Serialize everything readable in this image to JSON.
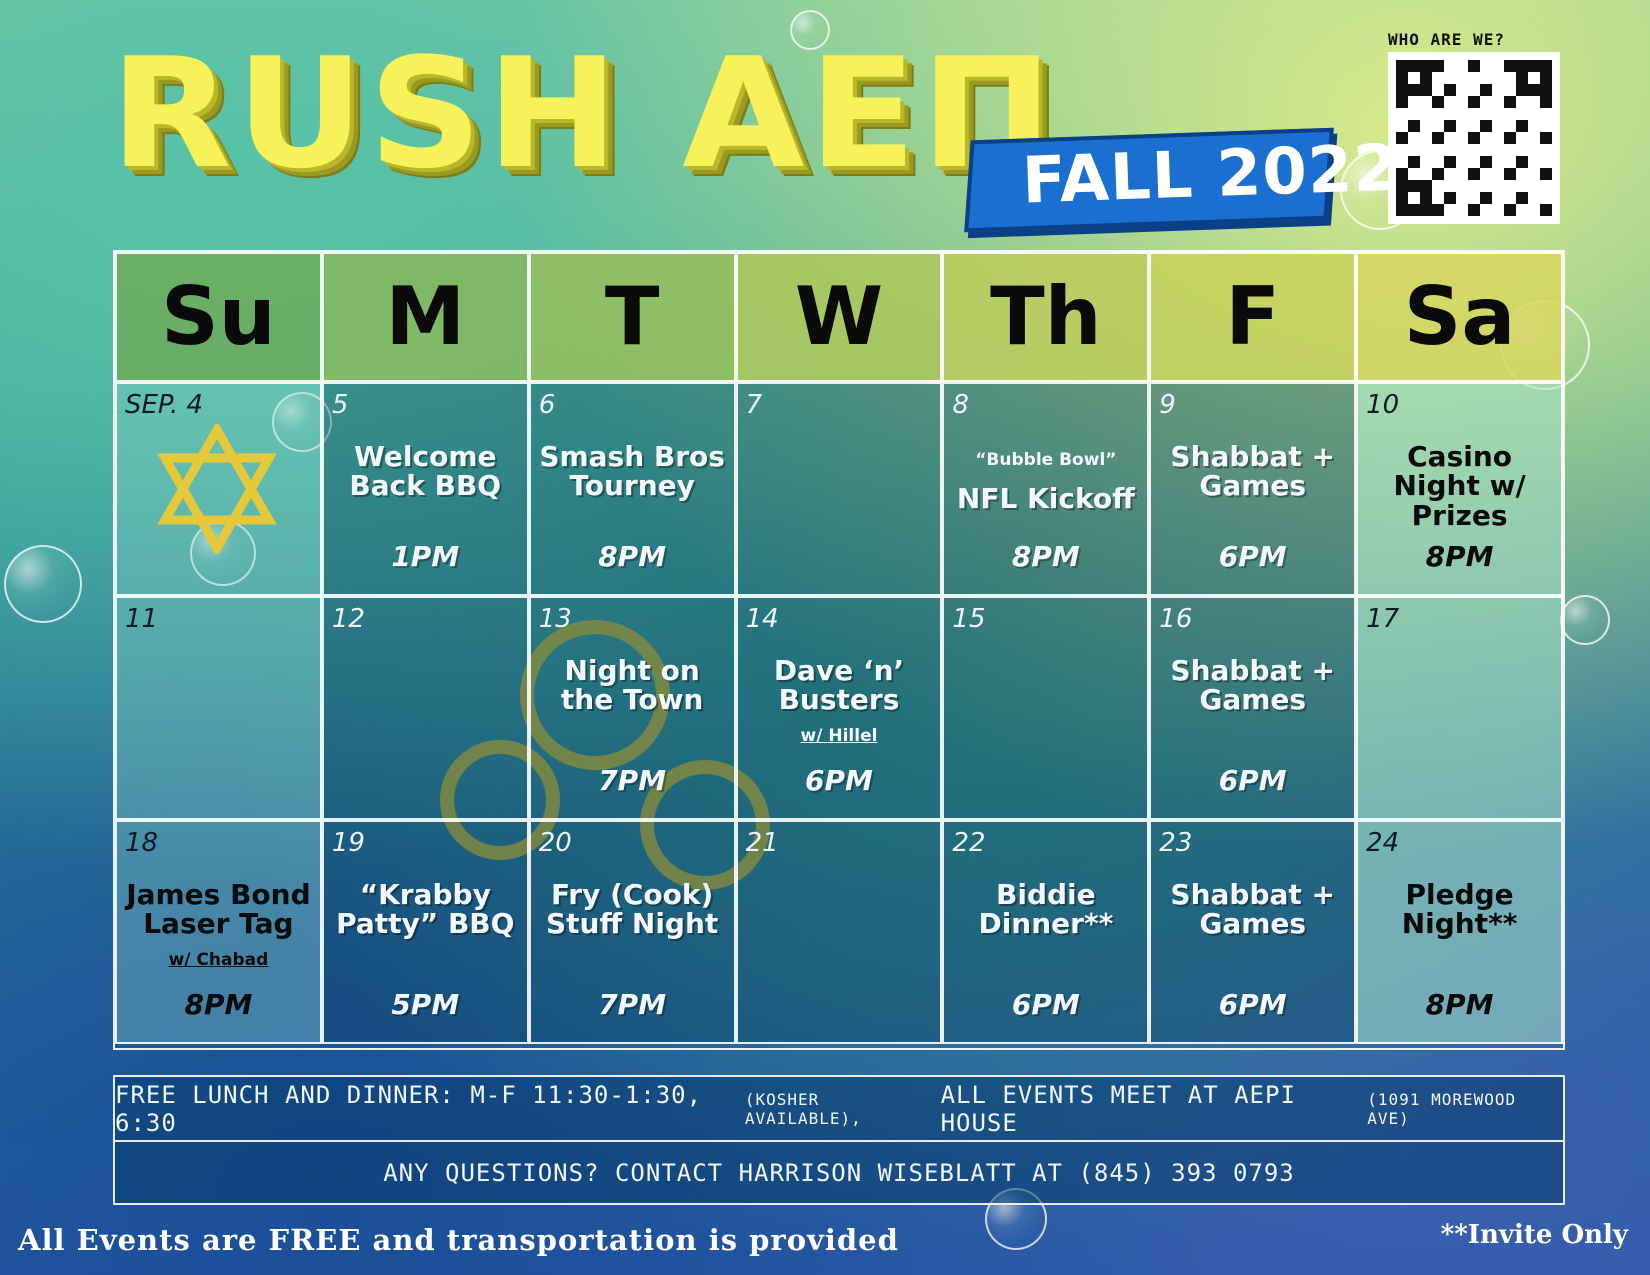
{
  "header": {
    "title": "RUSH AEΠ",
    "badge": "FALL 2022",
    "qr_label": "WHO ARE WE?"
  },
  "weekdays": [
    "Su",
    "M",
    "T",
    "W",
    "Th",
    "F",
    "Sa"
  ],
  "weeks": [
    [
      {
        "day": "SEP. 4",
        "title": "",
        "sub": "",
        "time": "",
        "star": true
      },
      {
        "day": "5",
        "title": "Welcome Back BBQ",
        "sub": "",
        "time": "1PM"
      },
      {
        "day": "6",
        "title": "Smash Bros Tourney",
        "sub": "",
        "time": "8PM"
      },
      {
        "day": "7",
        "title": "",
        "sub": "",
        "time": ""
      },
      {
        "day": "8",
        "pre": "“Bubble Bowl”",
        "title": "NFL Kickoff",
        "sub": "",
        "time": "8PM"
      },
      {
        "day": "9",
        "title": "Shabbat + Games",
        "sub": "",
        "time": "6PM"
      },
      {
        "day": "10",
        "title": "Casino Night w/ Prizes",
        "sub": "",
        "time": "8PM"
      }
    ],
    [
      {
        "day": "11",
        "title": "",
        "sub": "",
        "time": ""
      },
      {
        "day": "12",
        "title": "",
        "sub": "",
        "time": ""
      },
      {
        "day": "13",
        "title": "Night on the Town",
        "sub": "",
        "time": "7PM"
      },
      {
        "day": "14",
        "title": "Dave ‘n’ Busters",
        "sub": "w/ Hillel",
        "time": "6PM"
      },
      {
        "day": "15",
        "title": "",
        "sub": "",
        "time": ""
      },
      {
        "day": "16",
        "title": "Shabbat + Games",
        "sub": "",
        "time": "6PM"
      },
      {
        "day": "17",
        "title": "",
        "sub": "",
        "time": ""
      }
    ],
    [
      {
        "day": "18",
        "title": "James Bond Laser Tag",
        "sub": "w/ Chabad",
        "time": "8PM"
      },
      {
        "day": "19",
        "title": "“Krabby Patty” BBQ",
        "sub": "",
        "time": "5PM"
      },
      {
        "day": "20",
        "title": "Fry (Cook) Stuff Night",
        "sub": "",
        "time": "7PM"
      },
      {
        "day": "21",
        "title": "",
        "sub": "",
        "time": ""
      },
      {
        "day": "22",
        "title": "Biddie Dinner**",
        "sub": "",
        "time": "6PM"
      },
      {
        "day": "23",
        "title": "Shabbat + Games",
        "sub": "",
        "time": "6PM"
      },
      {
        "day": "24",
        "title": "Pledge Night**",
        "sub": "",
        "time": "8PM"
      }
    ]
  ],
  "info": {
    "line1_a": "FREE LUNCH AND DINNER: M-F 11:30-1:30, 6:30",
    "line1_b": "(KOSHER AVAILABLE),",
    "line1_c": "ALL EVENTS MEET AT AEPI HOUSE",
    "line1_d": "(1091 MOREWOOD AVE)",
    "line2": "ANY QUESTIONS? CONTACT HARRISON WISEBLATT AT (845) 393  0793"
  },
  "footer": {
    "left": "All Events are FREE and transportation is provided",
    "right": "**Invite Only"
  },
  "colors": {
    "title_yellow": "#f7f15a",
    "badge_blue": "#1a6fd0",
    "star_gold": "#e6c93a"
  }
}
